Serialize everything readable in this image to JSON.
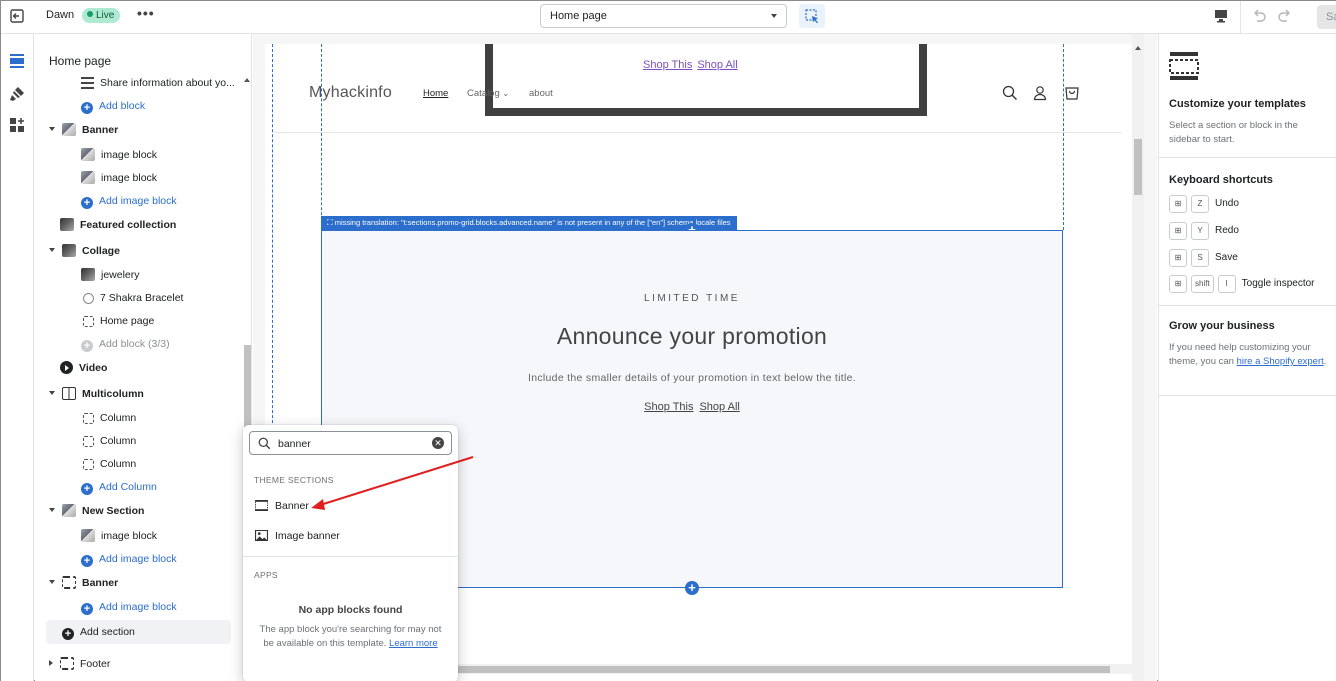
{
  "topbar": {
    "theme_name": "Dawn",
    "status_badge": "Live",
    "more_label": "•••",
    "page_select_value": "Home page",
    "save_label": "Sa"
  },
  "sidebar": {
    "title": "Home page",
    "rows": [
      {
        "label": "Share information about yo...",
        "kind": "block",
        "icon": "text-icon"
      },
      {
        "label": "Add block",
        "kind": "add"
      },
      {
        "label": "Banner",
        "kind": "section",
        "icon": "image-thumbnail"
      },
      {
        "label": "image block",
        "kind": "block",
        "icon": "image-thumbnail"
      },
      {
        "label": "image block",
        "kind": "block",
        "icon": "image-thumbnail"
      },
      {
        "label": "Add image block",
        "kind": "add"
      },
      {
        "label": "Featured collection",
        "kind": "section",
        "icon": "image-thumbnail"
      },
      {
        "label": "Collage",
        "kind": "section",
        "icon": "image-thumbnail"
      },
      {
        "label": "jewelery",
        "kind": "block",
        "icon": "image-thumbnail"
      },
      {
        "label": "7 Shakra Bracelet",
        "kind": "block",
        "icon": "product-icon"
      },
      {
        "label": "Home page",
        "kind": "block",
        "icon": "bracket-icon"
      },
      {
        "label": "Add block (3/3)",
        "kind": "add-disabled"
      },
      {
        "label": "Video",
        "kind": "section",
        "icon": "play-icon"
      },
      {
        "label": "Multicolumn",
        "kind": "section",
        "icon": "columns-icon"
      },
      {
        "label": "Column",
        "kind": "block",
        "icon": "bracket-icon"
      },
      {
        "label": "Column",
        "kind": "block",
        "icon": "bracket-icon"
      },
      {
        "label": "Column",
        "kind": "block",
        "icon": "bracket-icon"
      },
      {
        "label": "Add Column",
        "kind": "add"
      },
      {
        "label": "New Section",
        "kind": "section",
        "icon": "image-thumbnail"
      },
      {
        "label": "image block",
        "kind": "block",
        "icon": "image-thumbnail"
      },
      {
        "label": "Add image block",
        "kind": "add"
      },
      {
        "label": "Banner",
        "kind": "section",
        "icon": "section-icon"
      },
      {
        "label": "Add image block",
        "kind": "add"
      }
    ],
    "add_section_label": "Add section",
    "footer_label": "Footer"
  },
  "preview": {
    "top_banner_links": [
      "Shop This",
      "Shop All"
    ],
    "store_logo": "Myhackinfo",
    "nav": {
      "home": "Home",
      "catalog": "Catalog",
      "about": "about"
    },
    "warning_tag": "missing translation: \"t:sections.promo-grid.blocks.advanced.name\" is not present in any of the [\"en\"] schema locale files",
    "promo": {
      "kicker": "LIMITED TIME",
      "title": "Announce your promotion",
      "subtitle": "Include the smaller details of your promotion in text below the title.",
      "links": [
        "Shop This",
        "Shop All"
      ]
    }
  },
  "popover": {
    "search_value": "banner",
    "theme_sections_label": "THEME SECTIONS",
    "results": [
      {
        "label": "Banner",
        "icon": "section-icon"
      },
      {
        "label": "Image banner",
        "icon": "image-icon"
      }
    ],
    "apps_label": "APPS",
    "no_apps_title": "No app blocks found",
    "no_apps_body": "The app block you're searching for may not be available on this template.",
    "learn_more": "Learn more"
  },
  "right_panel": {
    "customize_title": "Customize your templates",
    "customize_body": "Select a section or block in the sidebar to start.",
    "shortcuts_title": "Keyboard shortcuts",
    "shortcuts": [
      {
        "keys": [
          "⊞",
          "Z"
        ],
        "label": "Undo"
      },
      {
        "keys": [
          "⊞",
          "Y"
        ],
        "label": "Redo"
      },
      {
        "keys": [
          "⊞",
          "S"
        ],
        "label": "Save"
      },
      {
        "keys": [
          "⊞",
          "shift",
          "I"
        ],
        "label": "Toggle inspector"
      }
    ],
    "grow_title": "Grow your business",
    "grow_body": "If you need help customizing your theme, you can",
    "grow_link": "hire a Shopify expert",
    "grow_end": "."
  },
  "colors": {
    "accent": "#2c6ecb",
    "live_bg": "#aee9d1",
    "annotation_arrow": "#e02020",
    "banner_border": "#404040",
    "store_link": "#7d4fc2"
  }
}
